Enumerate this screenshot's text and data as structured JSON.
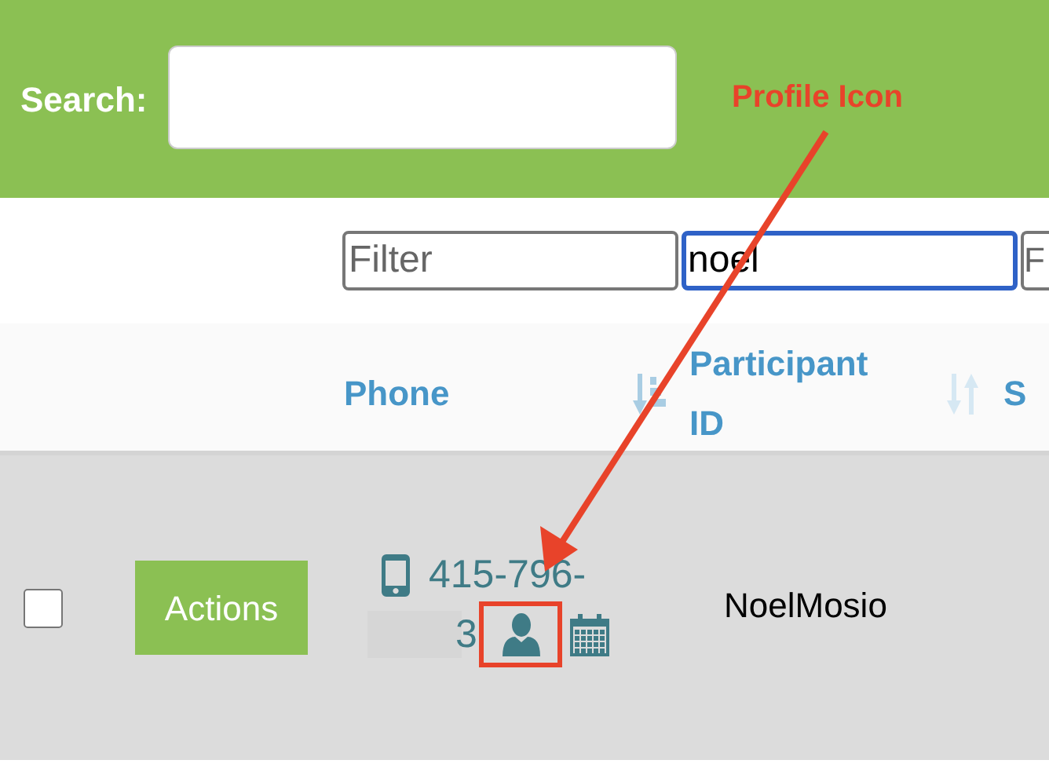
{
  "search": {
    "label": "Search:"
  },
  "annotation": {
    "label": "Profile Icon"
  },
  "filters": [
    {
      "placeholder": "Filter",
      "focused": false
    },
    {
      "value": "noel",
      "focused": true
    },
    {
      "placeholder": "F",
      "focused": false
    }
  ],
  "columns": [
    {
      "label": "Phone",
      "sorted": true
    },
    {
      "label": "Participant ID",
      "sorted": false
    },
    {
      "label": "S"
    }
  ],
  "rows": [
    {
      "checked": false,
      "action": "Actions",
      "phone_line_1": "415-796-",
      "phone_line_2": "3",
      "participant_id": "NoelMosio"
    }
  ]
}
